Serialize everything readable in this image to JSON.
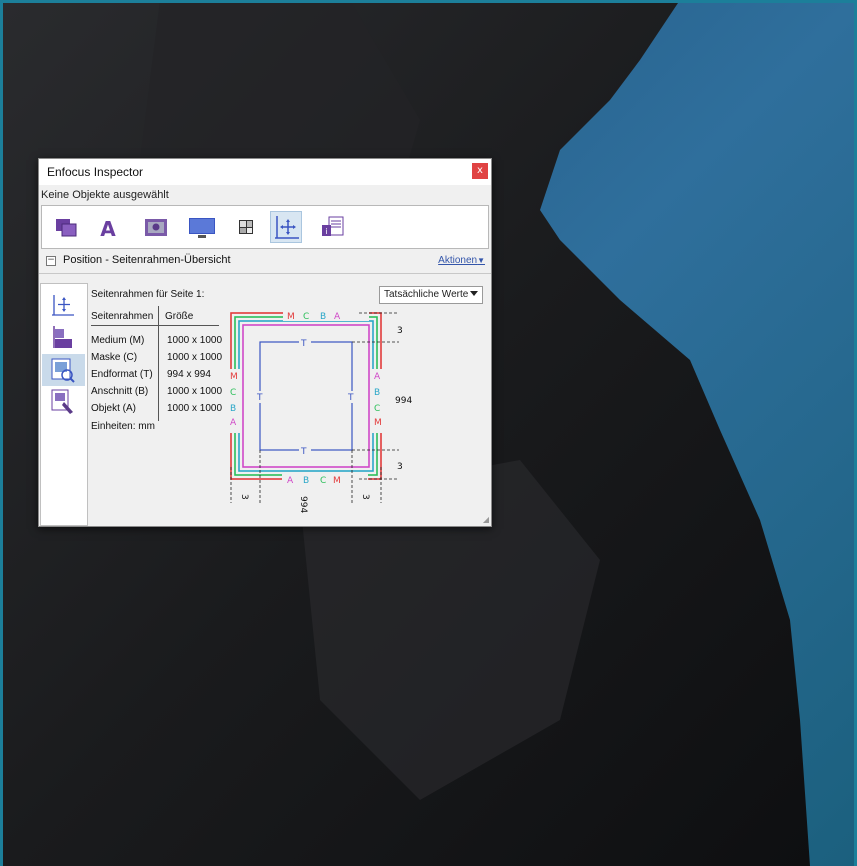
{
  "window": {
    "title": "Enfocus Inspector",
    "close_glyph": "x",
    "subtitle": "Keine Objekte ausgewählt"
  },
  "toolbar": {
    "buttons": [
      {
        "icon": "object-stack-icon"
      },
      {
        "icon": "text-icon",
        "glyph": "A"
      },
      {
        "icon": "image-icon"
      },
      {
        "icon": "monitor-icon"
      },
      {
        "icon": "color-grid-icon"
      },
      {
        "icon": "position-move-icon",
        "active": true
      },
      {
        "icon": "document-info-icon"
      }
    ]
  },
  "section": {
    "collapse_glyph": "−",
    "title": "Position - Seitenrahmen-Übersicht",
    "actions_label": "Aktionen",
    "actions_caret": "▼"
  },
  "sidetabs": [
    {
      "icon": "position-move-icon"
    },
    {
      "icon": "align-icon"
    },
    {
      "icon": "zoom-page-icon",
      "active": true
    },
    {
      "icon": "page-settings-icon"
    }
  ],
  "content": {
    "heading": "Seitenrahmen für Seite 1:",
    "dropdown_value": "Tatsächliche Werte",
    "table": {
      "col1_header": "Seitenrahmen",
      "col2_header": "Größe",
      "rows": [
        {
          "name": "Medium (M)",
          "size": "1000 x 1000"
        },
        {
          "name": "Maske (C)",
          "size": "1000 x 1000"
        },
        {
          "name": "Endformat (T)",
          "size": "994 x 994"
        },
        {
          "name": "Anschnitt (B)",
          "size": "1000 x 1000"
        },
        {
          "name": "Objekt (A)",
          "size": "1000 x 1000"
        }
      ]
    },
    "units": "Einheiten: mm"
  },
  "diagram": {
    "top_labels": [
      "M",
      "C",
      "B",
      "A"
    ],
    "bottom_labels": [
      "A",
      "B",
      "C",
      "M"
    ],
    "left_labels": [
      "M",
      "C",
      "B",
      "A"
    ],
    "right_labels": [
      "A",
      "B",
      "C",
      "M"
    ],
    "trim_label": "T",
    "dim_top": "3",
    "dim_bottom": "3",
    "dim_right": "994",
    "dim_bottom_left": "3",
    "dim_bottom_mid": "994",
    "dim_bottom_right": "3",
    "colors": {
      "medium": "#e23b3b",
      "mask": "#2cbf5a",
      "bleed": "#2aa7c8",
      "object": "#d048c8",
      "trim": "#3a55c2"
    }
  }
}
